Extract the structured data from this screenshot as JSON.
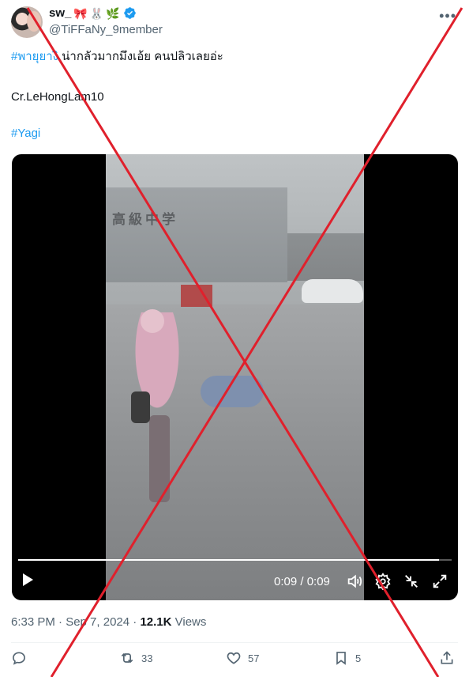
{
  "author": {
    "display_name": "sw_",
    "emojis": [
      "🎀",
      "🐰",
      "🌿"
    ],
    "handle": "@TiFFaNy_9member",
    "verified": true
  },
  "tweet": {
    "hashtag1": "#พายุยางิ",
    "text1": "น่ากลัวมากมึงเอ้ย คนปลิวเลยอ่ะ",
    "text2": "Cr.LeHongLam10",
    "hashtag2": "#Yagi"
  },
  "video": {
    "sign_text": "高級中学",
    "time_display": "0:09 / 0:09",
    "progress": 0.97,
    "icons": [
      "play-icon",
      "volume-icon",
      "settings-icon",
      "minimize-icon",
      "fullscreen-icon"
    ]
  },
  "meta": {
    "timestamp": "6:33 PM · Sep 7, 2024 · ",
    "views_count": "12.1K",
    "views_label": " Views"
  },
  "actions": {
    "replies": "",
    "retweets": "33",
    "likes": "57",
    "bookmarks": "5"
  },
  "colors": {
    "accent": "#1d9bf0",
    "secondary_text": "#536471",
    "overlay_cross": "#e0202c"
  }
}
